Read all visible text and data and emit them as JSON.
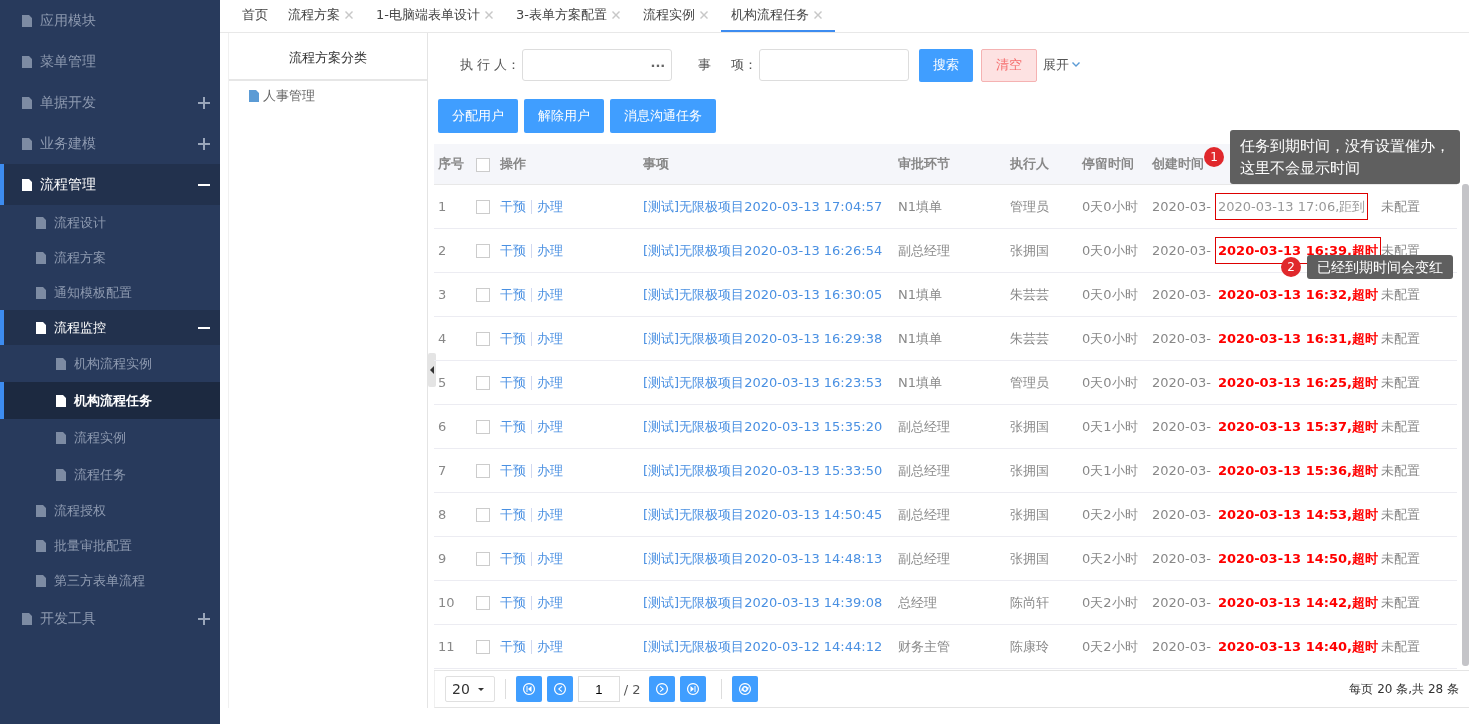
{
  "sidebar": {
    "items": [
      {
        "label": "应用模块",
        "selected": false
      },
      {
        "label": "菜单管理",
        "selected": false
      },
      {
        "label": "单据开发",
        "selected": false,
        "expanded": false
      },
      {
        "label": "业务建模",
        "selected": false,
        "expanded": false
      },
      {
        "label": "流程管理",
        "selected": false,
        "expanded": true,
        "children": [
          {
            "label": "流程设计",
            "selected": false
          },
          {
            "label": "流程方案",
            "selected": false
          },
          {
            "label": "通知模板配置",
            "selected": false
          },
          {
            "label": "流程监控",
            "selected": false,
            "expanded": true,
            "children": [
              {
                "label": "机构流程实例",
                "selected": false
              },
              {
                "label": "机构流程任务",
                "selected": true
              },
              {
                "label": "流程实例",
                "selected": false
              },
              {
                "label": "流程任务",
                "selected": false
              }
            ]
          },
          {
            "label": "流程授权",
            "selected": false
          },
          {
            "label": "批量审批配置",
            "selected": false
          },
          {
            "label": "第三方表单流程",
            "selected": false
          }
        ]
      },
      {
        "label": "开发工具",
        "selected": false,
        "expanded": false
      }
    ]
  },
  "tabs": [
    {
      "label": "首页",
      "selected": false,
      "closable": false
    },
    {
      "label": "流程方案",
      "selected": false,
      "closable": true
    },
    {
      "label": "1-电脑端表单设计",
      "selected": false,
      "closable": true
    },
    {
      "label": "3-表单方案配置",
      "selected": false,
      "closable": true
    },
    {
      "label": "流程实例",
      "selected": false,
      "closable": true
    },
    {
      "label": "机构流程任务",
      "selected": true,
      "closable": true
    }
  ],
  "category_panel": {
    "title": "流程方案分类",
    "tree": [
      {
        "label": "人事管理"
      }
    ]
  },
  "filters": {
    "executor_label": "执 行 人：",
    "executor_button": "···",
    "item_label_1": "事",
    "item_label_2": "项：",
    "search": "搜索",
    "clear": "清空",
    "expand": "展开"
  },
  "actions": [
    "分配用户",
    "解除用户",
    "消息沟通任务"
  ],
  "table": {
    "select_all_checked": false,
    "columns": [
      "序号",
      "",
      "操作",
      "事项",
      "审批环节",
      "执行人",
      "停留时间",
      "创建时间",
      "",
      ""
    ],
    "rows": [
      {
        "no": "1",
        "checked": false,
        "ops": [
          "干预",
          "办理"
        ],
        "item": "[测试]无限极项目2020-03-13 17:04:57",
        "step": "N1填单",
        "executor": "管理员",
        "stay": "0天0小时",
        "created": "2020-03-",
        "due": "2020-03-13 17:06,距到",
        "overdue": false,
        "highlighted": true,
        "timeout": "未配置"
      },
      {
        "no": "2",
        "checked": false,
        "ops": [
          "干预",
          "办理"
        ],
        "item": "[测试]无限极项目2020-03-13 16:26:54",
        "step": "副总经理",
        "executor": "张拥国",
        "stay": "0天0小时",
        "created": "2020-03-",
        "due": "2020-03-13 16:39,超时",
        "overdue": true,
        "highlighted": true,
        "timeout": "未配置"
      },
      {
        "no": "3",
        "checked": false,
        "ops": [
          "干预",
          "办理"
        ],
        "item": "[测试]无限极项目2020-03-13 16:30:05",
        "step": "N1填单",
        "executor": "朱芸芸",
        "stay": "0天0小时",
        "created": "2020-03-",
        "due": "2020-03-13 16:32,超时",
        "overdue": true,
        "highlighted": false,
        "timeout": "未配置"
      },
      {
        "no": "4",
        "checked": false,
        "ops": [
          "干预",
          "办理"
        ],
        "item": "[测试]无限极项目2020-03-13 16:29:38",
        "step": "N1填单",
        "executor": "朱芸芸",
        "stay": "0天0小时",
        "created": "2020-03-",
        "due": "2020-03-13 16:31,超时",
        "overdue": true,
        "highlighted": false,
        "timeout": "未配置"
      },
      {
        "no": "5",
        "checked": false,
        "ops": [
          "干预",
          "办理"
        ],
        "item": "[测试]无限极项目2020-03-13 16:23:53",
        "step": "N1填单",
        "executor": "管理员",
        "stay": "0天0小时",
        "created": "2020-03-",
        "due": "2020-03-13 16:25,超时",
        "overdue": true,
        "highlighted": false,
        "timeout": "未配置"
      },
      {
        "no": "6",
        "checked": false,
        "ops": [
          "干预",
          "办理"
        ],
        "item": "[测试]无限极项目2020-03-13 15:35:20",
        "step": "副总经理",
        "executor": "张拥国",
        "stay": "0天1小时",
        "created": "2020-03-",
        "due": "2020-03-13 15:37,超时",
        "overdue": true,
        "highlighted": false,
        "timeout": "未配置"
      },
      {
        "no": "7",
        "checked": false,
        "ops": [
          "干预",
          "办理"
        ],
        "item": "[测试]无限极项目2020-03-13 15:33:50",
        "step": "副总经理",
        "executor": "张拥国",
        "stay": "0天1小时",
        "created": "2020-03-",
        "due": "2020-03-13 15:36,超时",
        "overdue": true,
        "highlighted": false,
        "timeout": "未配置"
      },
      {
        "no": "8",
        "checked": false,
        "ops": [
          "干预",
          "办理"
        ],
        "item": "[测试]无限极项目2020-03-13 14:50:45",
        "step": "副总经理",
        "executor": "张拥国",
        "stay": "0天2小时",
        "created": "2020-03-",
        "due": "2020-03-13 14:53,超时",
        "overdue": true,
        "highlighted": false,
        "timeout": "未配置"
      },
      {
        "no": "9",
        "checked": false,
        "ops": [
          "干预",
          "办理"
        ],
        "item": "[测试]无限极项目2020-03-13 14:48:13",
        "step": "副总经理",
        "executor": "张拥国",
        "stay": "0天2小时",
        "created": "2020-03-",
        "due": "2020-03-13 14:50,超时",
        "overdue": true,
        "highlighted": false,
        "timeout": "未配置"
      },
      {
        "no": "10",
        "checked": false,
        "ops": [
          "干预",
          "办理"
        ],
        "item": "[测试]无限极项目2020-03-13 14:39:08",
        "step": "总经理",
        "executor": "陈尚轩",
        "stay": "0天2小时",
        "created": "2020-03-",
        "due": "2020-03-13 14:42,超时",
        "overdue": true,
        "highlighted": false,
        "timeout": "未配置"
      },
      {
        "no": "11",
        "checked": false,
        "ops": [
          "干预",
          "办理"
        ],
        "item": "[测试]无限极项目2020-03-12 14:44:12",
        "step": "财务主管",
        "executor": "陈康玲",
        "stay": "0天2小时",
        "created": "2020-03-",
        "due": "2020-03-13 14:40,超时",
        "overdue": true,
        "highlighted": false,
        "timeout": "未配置"
      }
    ]
  },
  "pagination": {
    "page_size": "20",
    "page": "1",
    "total_pages": "/ 2",
    "summary": "每页 20 条,共 28 条"
  },
  "callouts": [
    {
      "number": "1",
      "text": "任务到期时间，没有设置催办，这里不会显示时间"
    },
    {
      "number": "2",
      "text": "已经到期时间会变红"
    }
  ]
}
